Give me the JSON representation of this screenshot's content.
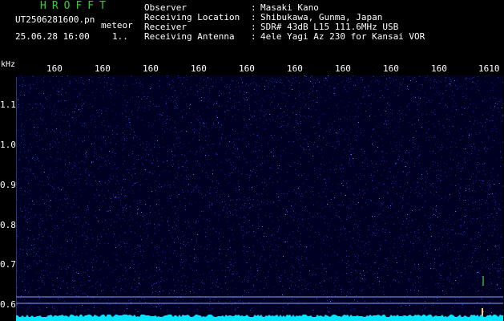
{
  "header": {
    "logo": "HROFFT",
    "filename": "UT2506281600.pn",
    "mode": "meteor",
    "datetime": "25.06.28 16:00",
    "index": "1.."
  },
  "meta": {
    "observer_label": "Observer",
    "observer_value": "Masaki Kano",
    "location_label": "Receiving Location",
    "location_value": "Shibukawa, Gunma, Japan",
    "receiver_label": "Receiver",
    "receiver_value": "SDR# 43dB L15 111.6MHz USB",
    "antenna_label": "Receiving Antenna",
    "antenna_value": "4ele Yagi Az 230 for Kansai VOR",
    "colon": ":"
  },
  "axis": {
    "y_unit": "kHz",
    "y_ticks": [
      "1.1",
      "1.0",
      "0.9",
      "0.8",
      "0.7",
      "0.6"
    ],
    "x_ticks": [
      "160",
      "160",
      "160",
      "160",
      "160",
      "160",
      "160",
      "160",
      "160",
      "1610"
    ]
  },
  "colors": {
    "background": "#000000",
    "plot_bg": "#000022",
    "noise": "#1a2eb8",
    "baseline": "#00e5ff",
    "logo": "#2fd12f",
    "text": "#ffffff"
  }
}
